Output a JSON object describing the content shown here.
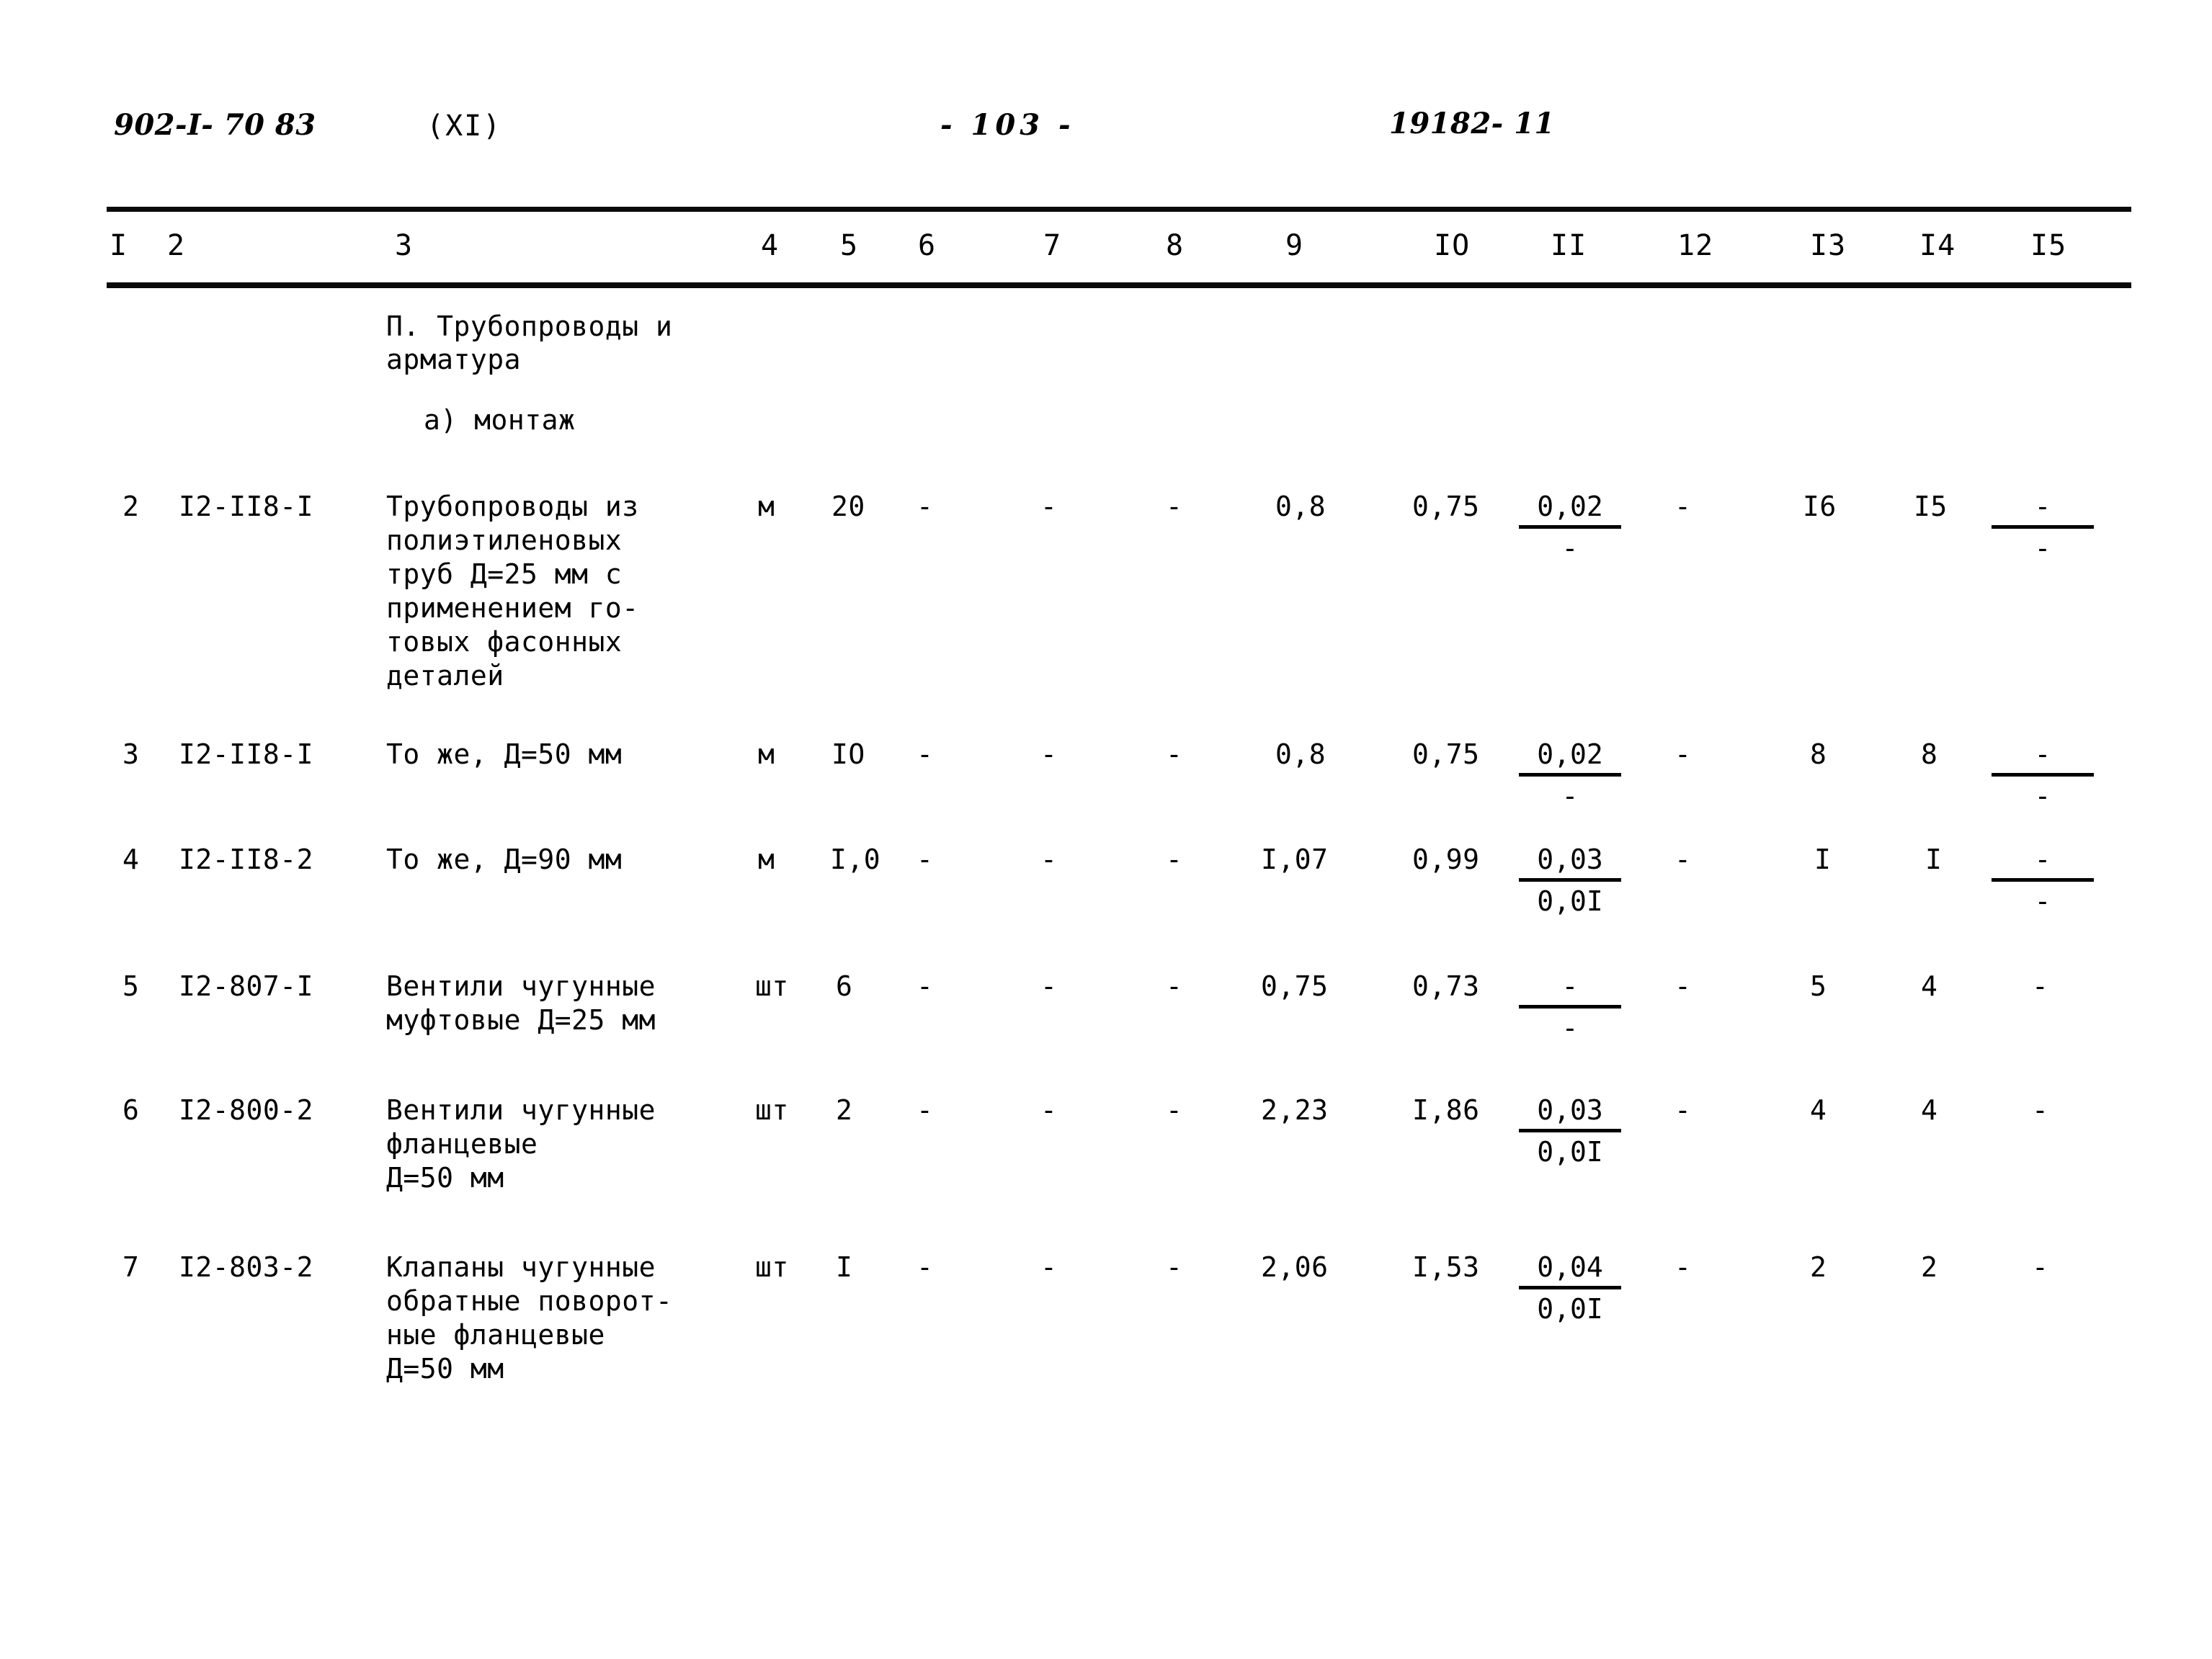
{
  "header": {
    "doc_code": "902-I- 70 83",
    "volume": "(XI)",
    "page_number": "-  103  -",
    "right_code": "19182- 11"
  },
  "column_numbers": [
    "I",
    "2",
    "3",
    "4",
    "5",
    "6",
    "7",
    "8",
    "9",
    "IO",
    "II",
    "12",
    "I3",
    "I4",
    "I5"
  ],
  "section": {
    "heading": "П. Трубопроводы и\nарматура",
    "subheading": "а) монтаж"
  },
  "rows": [
    {
      "no": "2",
      "code": "I2-II8-I",
      "description": "Трубопроводы из\nполиэтиленовых\nтруб Д=25 мм с\nприменением го-\nтовых фасонных\nдеталей",
      "unit": "м",
      "c5": "20",
      "c6": "-",
      "c7": "-",
      "c8": "-",
      "c9": "0,8",
      "c10": "0,75",
      "c11_numer": "0,02",
      "c11_denom": "-",
      "c12": "-",
      "c13": "I6",
      "c14": "I5",
      "c15_numer": "-",
      "c15_denom": "-"
    },
    {
      "no": "3",
      "code": "I2-II8-I",
      "description": "То же, Д=50 мм",
      "unit": "м",
      "c5": "IO",
      "c6": "-",
      "c7": "-",
      "c8": "-",
      "c9": "0,8",
      "c10": "0,75",
      "c11_numer": "0,02",
      "c11_denom": "-",
      "c12": "-",
      "c13": "8",
      "c14": "8",
      "c15_numer": "-",
      "c15_denom": "-"
    },
    {
      "no": "4",
      "code": "I2-II8-2",
      "description": "То же, Д=90 мм",
      "unit": "м",
      "c5": "I,0",
      "c6": "-",
      "c7": "-",
      "c8": "-",
      "c9": "I,07",
      "c10": "0,99",
      "c11_numer": "0,03",
      "c11_denom": "0,0I",
      "c12": "-",
      "c13": "I",
      "c14": "I",
      "c15_numer": "-",
      "c15_denom": "-"
    },
    {
      "no": "5",
      "code": "I2-807-I",
      "description": "Вентили чугунные\nмуфтовые Д=25 мм",
      "unit": "шт",
      "c5": "6",
      "c6": "-",
      "c7": "-",
      "c8": "-",
      "c9": "0,75",
      "c10": "0,73",
      "c11_numer": "-",
      "c11_denom": "-",
      "c12": "-",
      "c13": "5",
      "c14": "4",
      "c15_numer": "-",
      "c15_denom": ""
    },
    {
      "no": "6",
      "code": "I2-800-2",
      "description": "Вентили чугунные\nфланцевые\nД=50 мм",
      "unit": "шт",
      "c5": "2",
      "c6": "-",
      "c7": "-",
      "c8": "-",
      "c9": "2,23",
      "c10": "I,86",
      "c11_numer": "0,03",
      "c11_denom": "0,0I",
      "c12": "-",
      "c13": "4",
      "c14": "4",
      "c15_numer": "-",
      "c15_denom": ""
    },
    {
      "no": "7",
      "code": "I2-803-2",
      "description": "Клапаны чугунные\nобратные поворот-\nные фланцевые\nД=50 мм",
      "unit": "шт",
      "c5": "I",
      "c6": "-",
      "c7": "-",
      "c8": "-",
      "c9": "2,06",
      "c10": "I,53",
      "c11_numer": "0,04",
      "c11_denom": "0,0I",
      "c12": "-",
      "c13": "2",
      "c14": "2",
      "c15_numer": "-",
      "c15_denom": ""
    }
  ]
}
